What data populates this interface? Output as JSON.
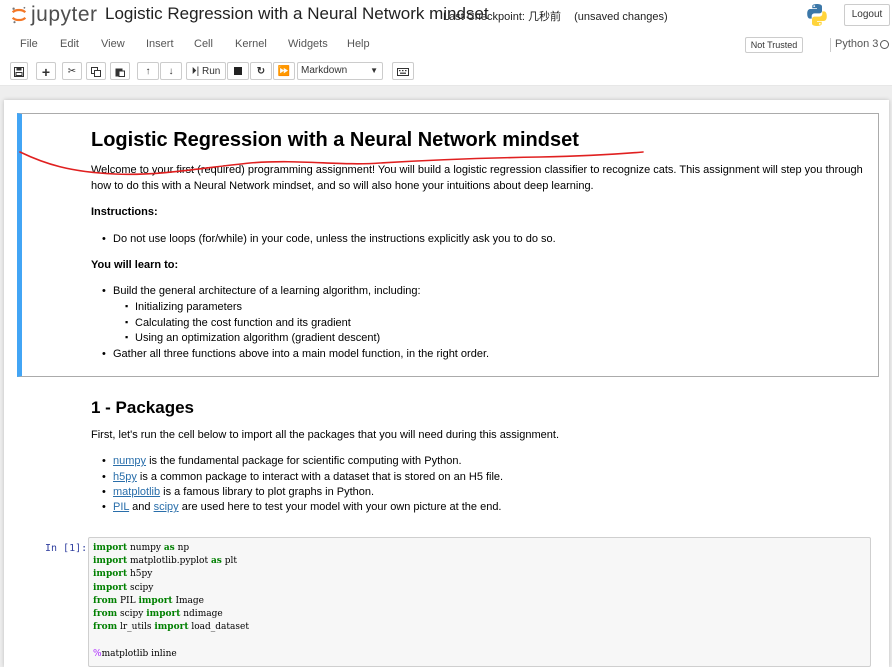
{
  "header": {
    "logo_text": "jupyter",
    "notebook_title": "Logistic Regression with a Neural Network mindset",
    "checkpoint_label": "Last Checkpoint:",
    "checkpoint_time": "几秒前",
    "unsaved": "(unsaved changes)",
    "logout_label": "Logout"
  },
  "menu": {
    "items": [
      "File",
      "Edit",
      "View",
      "Insert",
      "Cell",
      "Kernel",
      "Widgets",
      "Help"
    ],
    "trust_label": "Not Trusted",
    "kernel_name": "Python 3"
  },
  "toolbar": {
    "icons": [
      "save-icon",
      "add-cell-icon",
      "cut-icon",
      "copy-icon",
      "paste-icon",
      "move-up-icon",
      "move-down-icon",
      "run-icon",
      "stop-icon",
      "restart-icon",
      "fast-forward-icon"
    ],
    "run_label": "Run",
    "cell_type_value": "Markdown",
    "command_palette_icon": "keyboard-icon"
  },
  "markdown_cell": {
    "title": "Logistic Regression with a Neural Network mindset",
    "intro_line1": "Welcome to your first (required) programming assignment! You will build a logistic regression classifier to recognize cats. This assignment will step you through",
    "intro_line2": "how to do this with a Neural Network mindset, and so will also hone your intuitions about deep learning.",
    "instructions_heading": "Instructions:",
    "instructions": [
      "Do not use loops (for/while) in your code, unless the instructions explicitly ask you to do so."
    ],
    "learn_heading": "You will learn to:",
    "learn_item1": "Build the general architecture of a learning algorithm, including:",
    "learn_subitems": [
      "Initializing parameters",
      "Calculating the cost function and its gradient",
      "Using an optimization algorithm (gradient descent)"
    ],
    "learn_item2": "Gather all three functions above into a main model function, in the right order."
  },
  "packages_section": {
    "heading": "1 - Packages",
    "intro": "First, let's run the cell below to import all the packages that you will need during this assignment.",
    "items": [
      {
        "link": "numpy",
        "text": " is the fundamental package for scientific computing with Python."
      },
      {
        "link": "h5py",
        "text": " is a common package to interact with a dataset that is stored on an H5 file."
      },
      {
        "link": "matplotlib",
        "text": " is a famous library to plot graphs in Python."
      }
    ],
    "last_item": {
      "link1": "PIL",
      "and": " and ",
      "link2": "scipy",
      "text": " are used here to test your model with your own picture at the end."
    }
  },
  "code_cell": {
    "prompt": "In [1]:",
    "lines": [
      [
        {
          "t": "import",
          "k": "kw"
        },
        {
          "t": " numpy ",
          "k": ""
        },
        {
          "t": "as",
          "k": "kw"
        },
        {
          "t": " np",
          "k": ""
        }
      ],
      [
        {
          "t": "import",
          "k": "kw"
        },
        {
          "t": " matplotlib.pyplot ",
          "k": ""
        },
        {
          "t": "as",
          "k": "kw"
        },
        {
          "t": " plt",
          "k": ""
        }
      ],
      [
        {
          "t": "import",
          "k": "kw"
        },
        {
          "t": " h5py",
          "k": ""
        }
      ],
      [
        {
          "t": "import",
          "k": "kw"
        },
        {
          "t": " scipy",
          "k": ""
        }
      ],
      [
        {
          "t": "from",
          "k": "kw"
        },
        {
          "t": " PIL ",
          "k": ""
        },
        {
          "t": "import",
          "k": "kw"
        },
        {
          "t": " Image",
          "k": ""
        }
      ],
      [
        {
          "t": "from",
          "k": "kw"
        },
        {
          "t": " scipy ",
          "k": ""
        },
        {
          "t": "import",
          "k": "kw"
        },
        {
          "t": " ndimage",
          "k": ""
        }
      ],
      [
        {
          "t": "from",
          "k": "kw"
        },
        {
          "t": " lr_utils ",
          "k": ""
        },
        {
          "t": "import",
          "k": "kw"
        },
        {
          "t": " load_dataset",
          "k": ""
        }
      ],
      [],
      [
        {
          "t": "%",
          "k": "mg"
        },
        {
          "t": "matplotlib inline",
          "k": ""
        }
      ]
    ]
  },
  "colors": {
    "selected_cell_border": "#42a5f5",
    "link": "#296eaa",
    "annotation_stroke": "#e02020",
    "prompt": "#303f9f",
    "keyword": "#008000"
  }
}
